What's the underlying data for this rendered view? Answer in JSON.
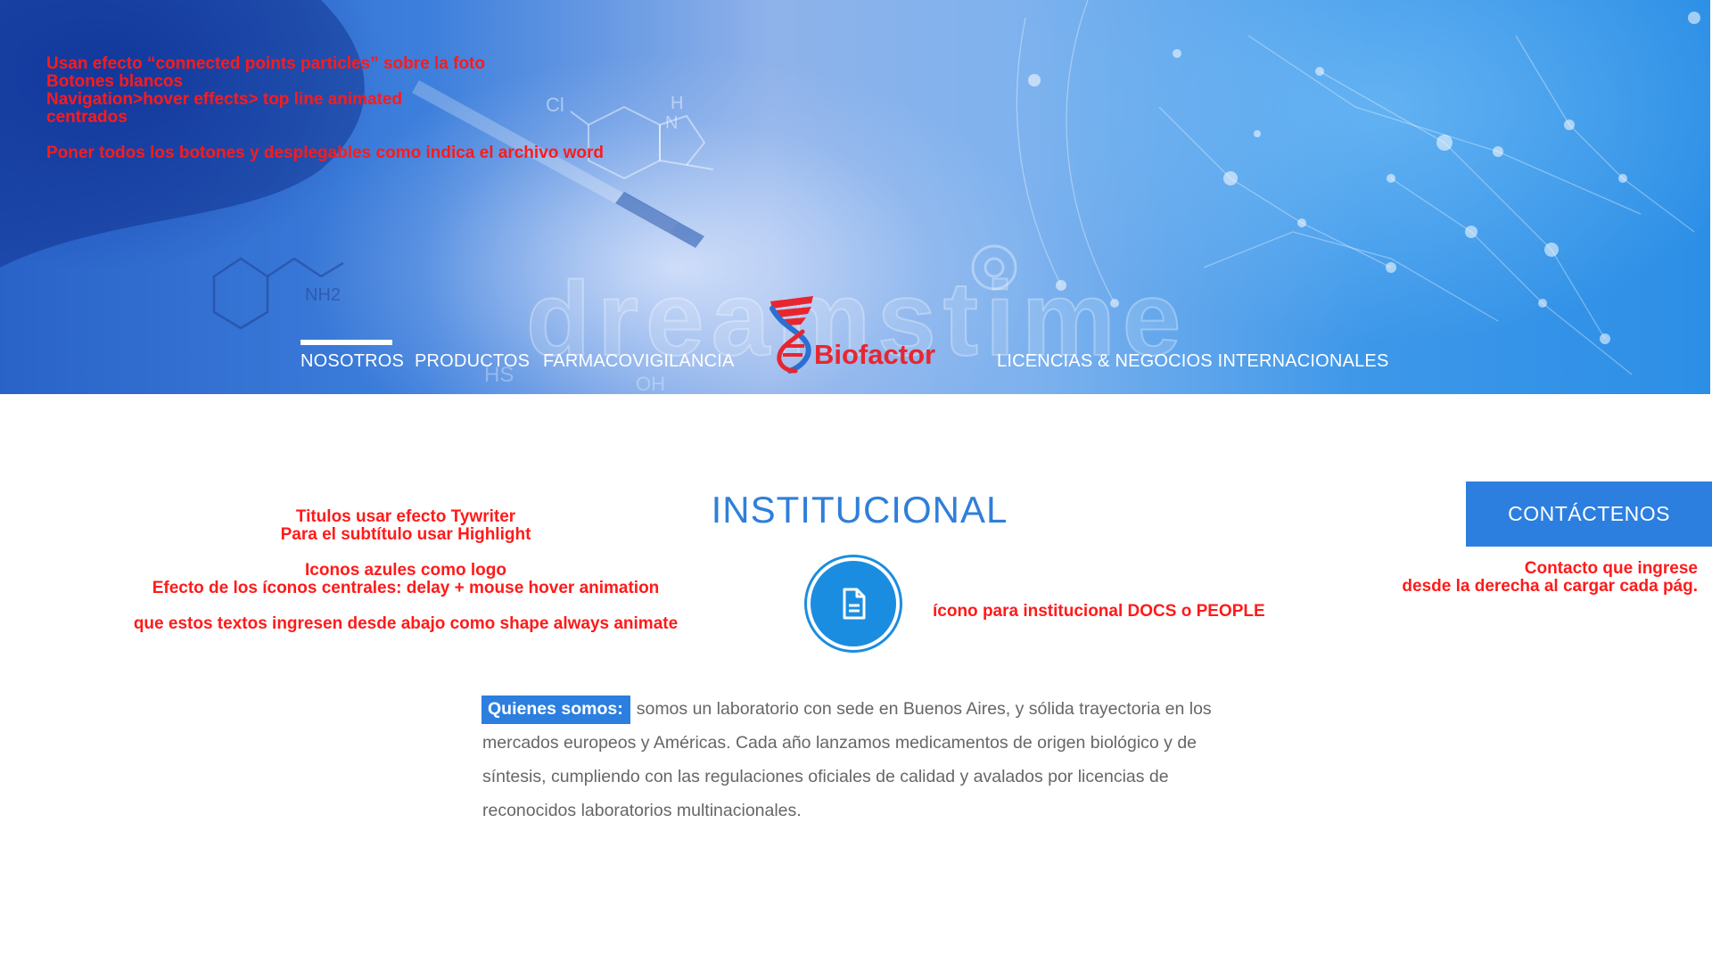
{
  "annotations": {
    "hero_notes": [
      "Usan efecto “connected points particles” sobre la foto",
      "Botones blancos",
      "Navigation>hover effects> top line animated",
      "centrados",
      "",
      "Poner todos los botones y desplegables como indica el archivo word"
    ],
    "left_notes": [
      "Titulos usar efecto Tywriter",
      "Para el subtítulo usar Highlight",
      "",
      "Iconos azules como logo",
      "Efecto de los íconos centrales: delay + mouse hover animation",
      "",
      "que estos textos ingresen desde abajo como shape always animate"
    ],
    "icon_note": "ícono para institucional DOCS o PEOPLE",
    "contact_notes": [
      "Contacto que ingrese",
      "desde la derecha al cargar cada pág."
    ]
  },
  "nav": {
    "items": [
      "NOSOTROS",
      "PRODUCTOS",
      "FARMACOVIGILANCIA",
      "LICENCIAS & NEGOCIOS INTERNACIONALES"
    ],
    "active": "NOSOTROS",
    "logo_text": "Biofactor"
  },
  "hero_image": {
    "watermark": "dreamstime",
    "chem_labels": [
      "Cl",
      "H",
      "N",
      "NH2",
      "HS",
      "OH"
    ]
  },
  "main": {
    "title": "INSTITUCIONAL",
    "center_icon": "document-icon",
    "contact_button": "CONTÁCTENOS",
    "about_label": "Quienes somos:",
    "about_text": "somos un laboratorio con sede en Buenos Aires, y sólida trayectoria en los mercados europeos y Américas. Cada año lanzamos medicamentos de origen biológico y de síntesis, cumpliendo con las regulaciones oficiales de calidad y avalados por licencias de reconocidos laboratorios multinacionales."
  },
  "colors": {
    "accent_blue": "#2c7fdf",
    "icon_blue": "#1b8de0",
    "annotation_red": "#ff1a1a",
    "logo_red": "#e8262f",
    "body_text": "#666666"
  }
}
